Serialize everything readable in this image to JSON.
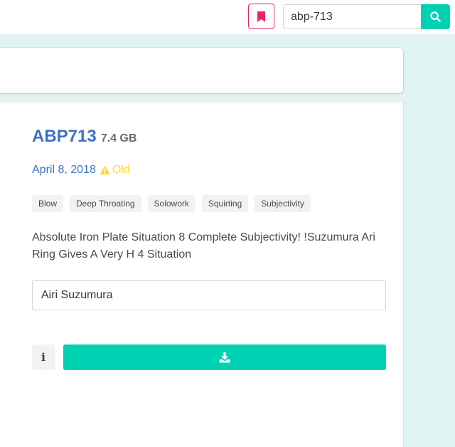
{
  "header": {
    "bookmark_icon": "bookmark-icon",
    "search": {
      "value": "abp-713",
      "icon": "search-icon"
    }
  },
  "movie": {
    "code": "ABP713",
    "size": "7.4 GB",
    "date": "April 8, 2018",
    "status_icon": "warning-icon",
    "status_label": "Old",
    "tags": [
      "Blow",
      "Deep Throating",
      "Solowork",
      "Squirting",
      "Subjectivity"
    ],
    "description": "Absolute Iron Plate Situation 8 Complete Subjectivity! !Suzumura Ari Ring Gives A Very H 4 Situation",
    "actress": "Airi Suzumura",
    "info_icon": "info-icon",
    "download_icon": "download-icon"
  },
  "colors": {
    "accent": "#00d1b2",
    "link": "#3d72c7",
    "warning": "#ffd83d",
    "bookmark": "#e8265c",
    "background": "#e0f5f2"
  }
}
